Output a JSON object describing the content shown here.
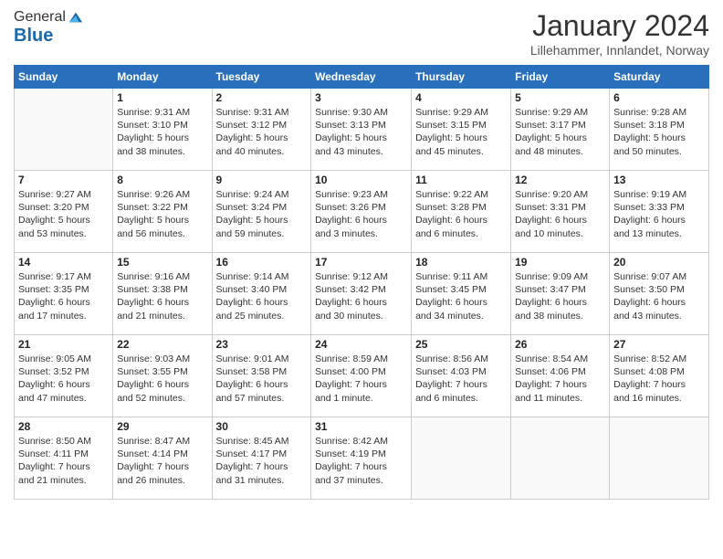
{
  "logo": {
    "line1": "General",
    "line2": "Blue"
  },
  "header": {
    "month": "January 2024",
    "location": "Lillehammer, Innlandet, Norway"
  },
  "weekdays": [
    "Sunday",
    "Monday",
    "Tuesday",
    "Wednesday",
    "Thursday",
    "Friday",
    "Saturday"
  ],
  "weeks": [
    [
      {
        "day": "",
        "info": ""
      },
      {
        "day": "1",
        "info": "Sunrise: 9:31 AM\nSunset: 3:10 PM\nDaylight: 5 hours\nand 38 minutes."
      },
      {
        "day": "2",
        "info": "Sunrise: 9:31 AM\nSunset: 3:12 PM\nDaylight: 5 hours\nand 40 minutes."
      },
      {
        "day": "3",
        "info": "Sunrise: 9:30 AM\nSunset: 3:13 PM\nDaylight: 5 hours\nand 43 minutes."
      },
      {
        "day": "4",
        "info": "Sunrise: 9:29 AM\nSunset: 3:15 PM\nDaylight: 5 hours\nand 45 minutes."
      },
      {
        "day": "5",
        "info": "Sunrise: 9:29 AM\nSunset: 3:17 PM\nDaylight: 5 hours\nand 48 minutes."
      },
      {
        "day": "6",
        "info": "Sunrise: 9:28 AM\nSunset: 3:18 PM\nDaylight: 5 hours\nand 50 minutes."
      }
    ],
    [
      {
        "day": "7",
        "info": "Sunrise: 9:27 AM\nSunset: 3:20 PM\nDaylight: 5 hours\nand 53 minutes."
      },
      {
        "day": "8",
        "info": "Sunrise: 9:26 AM\nSunset: 3:22 PM\nDaylight: 5 hours\nand 56 minutes."
      },
      {
        "day": "9",
        "info": "Sunrise: 9:24 AM\nSunset: 3:24 PM\nDaylight: 5 hours\nand 59 minutes."
      },
      {
        "day": "10",
        "info": "Sunrise: 9:23 AM\nSunset: 3:26 PM\nDaylight: 6 hours\nand 3 minutes."
      },
      {
        "day": "11",
        "info": "Sunrise: 9:22 AM\nSunset: 3:28 PM\nDaylight: 6 hours\nand 6 minutes."
      },
      {
        "day": "12",
        "info": "Sunrise: 9:20 AM\nSunset: 3:31 PM\nDaylight: 6 hours\nand 10 minutes."
      },
      {
        "day": "13",
        "info": "Sunrise: 9:19 AM\nSunset: 3:33 PM\nDaylight: 6 hours\nand 13 minutes."
      }
    ],
    [
      {
        "day": "14",
        "info": "Sunrise: 9:17 AM\nSunset: 3:35 PM\nDaylight: 6 hours\nand 17 minutes."
      },
      {
        "day": "15",
        "info": "Sunrise: 9:16 AM\nSunset: 3:38 PM\nDaylight: 6 hours\nand 21 minutes."
      },
      {
        "day": "16",
        "info": "Sunrise: 9:14 AM\nSunset: 3:40 PM\nDaylight: 6 hours\nand 25 minutes."
      },
      {
        "day": "17",
        "info": "Sunrise: 9:12 AM\nSunset: 3:42 PM\nDaylight: 6 hours\nand 30 minutes."
      },
      {
        "day": "18",
        "info": "Sunrise: 9:11 AM\nSunset: 3:45 PM\nDaylight: 6 hours\nand 34 minutes."
      },
      {
        "day": "19",
        "info": "Sunrise: 9:09 AM\nSunset: 3:47 PM\nDaylight: 6 hours\nand 38 minutes."
      },
      {
        "day": "20",
        "info": "Sunrise: 9:07 AM\nSunset: 3:50 PM\nDaylight: 6 hours\nand 43 minutes."
      }
    ],
    [
      {
        "day": "21",
        "info": "Sunrise: 9:05 AM\nSunset: 3:52 PM\nDaylight: 6 hours\nand 47 minutes."
      },
      {
        "day": "22",
        "info": "Sunrise: 9:03 AM\nSunset: 3:55 PM\nDaylight: 6 hours\nand 52 minutes."
      },
      {
        "day": "23",
        "info": "Sunrise: 9:01 AM\nSunset: 3:58 PM\nDaylight: 6 hours\nand 57 minutes."
      },
      {
        "day": "24",
        "info": "Sunrise: 8:59 AM\nSunset: 4:00 PM\nDaylight: 7 hours\nand 1 minute."
      },
      {
        "day": "25",
        "info": "Sunrise: 8:56 AM\nSunset: 4:03 PM\nDaylight: 7 hours\nand 6 minutes."
      },
      {
        "day": "26",
        "info": "Sunrise: 8:54 AM\nSunset: 4:06 PM\nDaylight: 7 hours\nand 11 minutes."
      },
      {
        "day": "27",
        "info": "Sunrise: 8:52 AM\nSunset: 4:08 PM\nDaylight: 7 hours\nand 16 minutes."
      }
    ],
    [
      {
        "day": "28",
        "info": "Sunrise: 8:50 AM\nSunset: 4:11 PM\nDaylight: 7 hours\nand 21 minutes."
      },
      {
        "day": "29",
        "info": "Sunrise: 8:47 AM\nSunset: 4:14 PM\nDaylight: 7 hours\nand 26 minutes."
      },
      {
        "day": "30",
        "info": "Sunrise: 8:45 AM\nSunset: 4:17 PM\nDaylight: 7 hours\nand 31 minutes."
      },
      {
        "day": "31",
        "info": "Sunrise: 8:42 AM\nSunset: 4:19 PM\nDaylight: 7 hours\nand 37 minutes."
      },
      {
        "day": "",
        "info": ""
      },
      {
        "day": "",
        "info": ""
      },
      {
        "day": "",
        "info": ""
      }
    ]
  ]
}
